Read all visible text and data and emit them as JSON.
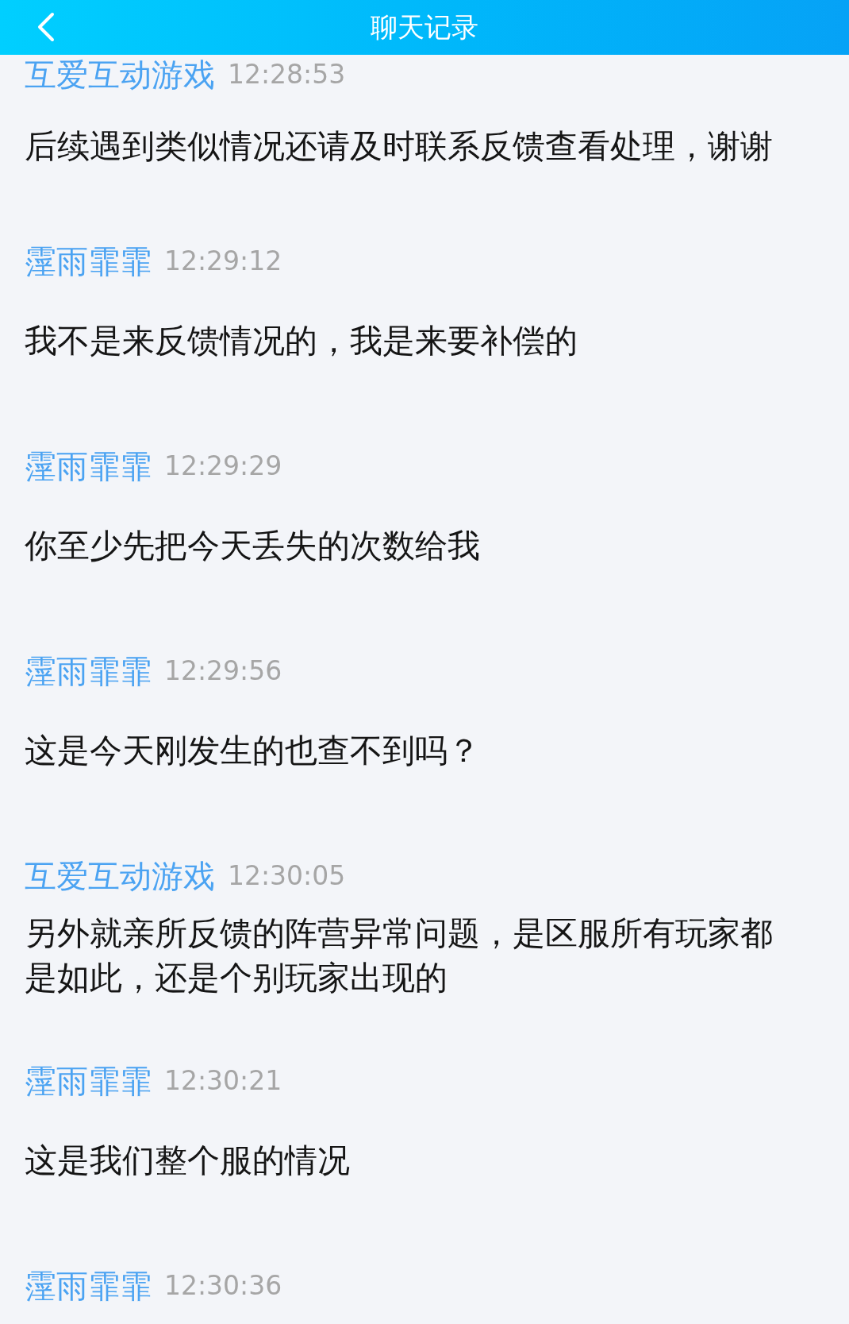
{
  "header": {
    "title": "聊天记录"
  },
  "messages": [
    {
      "sender": "互爱互动游戏",
      "time": "12:28:53",
      "text": "后续遇到类似情况还请及时联系反馈查看处理，谢谢"
    },
    {
      "sender": "霪雨霏霏",
      "time": "12:29:12",
      "text": "我不是来反馈情况的，我是来要补偿的"
    },
    {
      "sender": "霪雨霏霏",
      "time": "12:29:29",
      "text": "你至少先把今天丢失的次数给我"
    },
    {
      "sender": "霪雨霏霏",
      "time": "12:29:56",
      "text": "这是今天刚发生的也查不到吗？"
    },
    {
      "sender": "互爱互动游戏",
      "time": "12:30:05",
      "text": "另外就亲所反馈的阵营异常问题，是区服所有玩家都是如此，还是个别玩家出现的"
    },
    {
      "sender": "霪雨霏霏",
      "time": "12:30:21",
      "text": "这是我们整个服的情况"
    },
    {
      "sender": "霪雨霏霏",
      "time": "12:30:36"
    }
  ]
}
